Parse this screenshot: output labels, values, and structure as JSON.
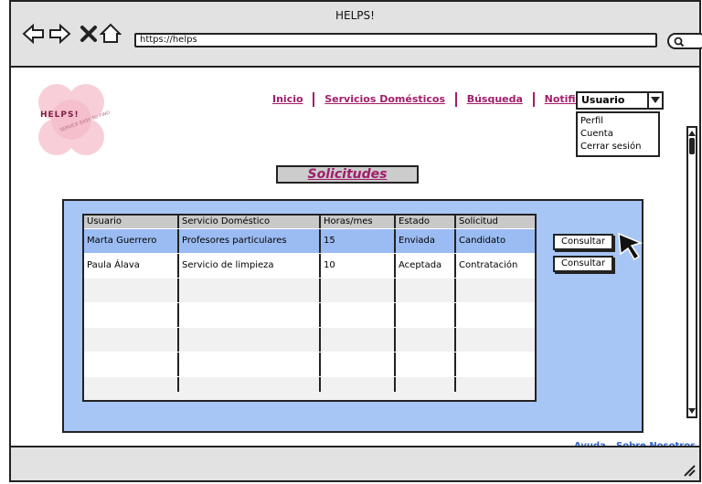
{
  "window": {
    "title": "HELPS!"
  },
  "browser": {
    "url": "https://helps"
  },
  "logo": {
    "name": "HELPS!",
    "tagline": "SERVICE EASY TO FIND"
  },
  "topnav": {
    "items": [
      {
        "label": "Inicio"
      },
      {
        "label": "Servicios Domésticos"
      },
      {
        "label": "Búsqueda"
      },
      {
        "label": "Notificaciones"
      }
    ]
  },
  "user_menu": {
    "selected": "Usuario",
    "options": [
      "Perfil",
      "Cuenta",
      "Cerrar sesión"
    ]
  },
  "section": {
    "title": "Solicitudes"
  },
  "table": {
    "headers": [
      "Usuario",
      "Servicio Doméstico",
      "Horas/mes",
      "Estado",
      "Solicitud"
    ],
    "rows": [
      [
        "Marta Guerrero",
        "Profesores particulares",
        "15",
        "Enviada",
        "Candidato"
      ],
      [
        "Paula Álava",
        "Servicio de limpieza",
        "10",
        "Aceptada",
        "Contratación"
      ]
    ]
  },
  "actions": {
    "consult_label": "Consultar"
  },
  "footer": {
    "help": "Ayuda",
    "about": "Sobre Nosotros"
  },
  "colors": {
    "accent": "#a11d6b",
    "panel": "#a8c6f5",
    "selected_row": "#9bbcf2",
    "link": "#2d63c8"
  }
}
